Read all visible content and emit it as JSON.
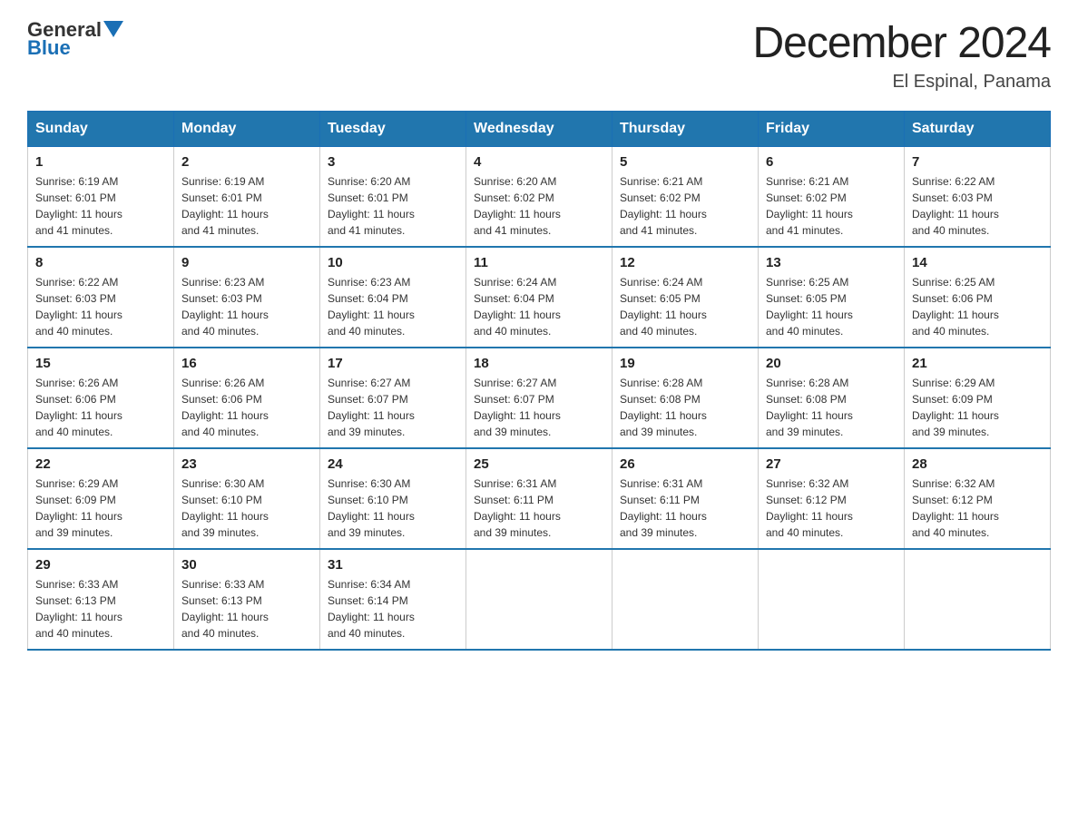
{
  "header": {
    "logo_general": "General",
    "logo_blue": "Blue",
    "title": "December 2024",
    "location": "El Espinal, Panama"
  },
  "weekdays": [
    "Sunday",
    "Monday",
    "Tuesday",
    "Wednesday",
    "Thursday",
    "Friday",
    "Saturday"
  ],
  "weeks": [
    [
      {
        "day": "1",
        "sunrise": "6:19 AM",
        "sunset": "6:01 PM",
        "daylight": "11 hours and 41 minutes."
      },
      {
        "day": "2",
        "sunrise": "6:19 AM",
        "sunset": "6:01 PM",
        "daylight": "11 hours and 41 minutes."
      },
      {
        "day": "3",
        "sunrise": "6:20 AM",
        "sunset": "6:01 PM",
        "daylight": "11 hours and 41 minutes."
      },
      {
        "day": "4",
        "sunrise": "6:20 AM",
        "sunset": "6:02 PM",
        "daylight": "11 hours and 41 minutes."
      },
      {
        "day": "5",
        "sunrise": "6:21 AM",
        "sunset": "6:02 PM",
        "daylight": "11 hours and 41 minutes."
      },
      {
        "day": "6",
        "sunrise": "6:21 AM",
        "sunset": "6:02 PM",
        "daylight": "11 hours and 41 minutes."
      },
      {
        "day": "7",
        "sunrise": "6:22 AM",
        "sunset": "6:03 PM",
        "daylight": "11 hours and 40 minutes."
      }
    ],
    [
      {
        "day": "8",
        "sunrise": "6:22 AM",
        "sunset": "6:03 PM",
        "daylight": "11 hours and 40 minutes."
      },
      {
        "day": "9",
        "sunrise": "6:23 AM",
        "sunset": "6:03 PM",
        "daylight": "11 hours and 40 minutes."
      },
      {
        "day": "10",
        "sunrise": "6:23 AM",
        "sunset": "6:04 PM",
        "daylight": "11 hours and 40 minutes."
      },
      {
        "day": "11",
        "sunrise": "6:24 AM",
        "sunset": "6:04 PM",
        "daylight": "11 hours and 40 minutes."
      },
      {
        "day": "12",
        "sunrise": "6:24 AM",
        "sunset": "6:05 PM",
        "daylight": "11 hours and 40 minutes."
      },
      {
        "day": "13",
        "sunrise": "6:25 AM",
        "sunset": "6:05 PM",
        "daylight": "11 hours and 40 minutes."
      },
      {
        "day": "14",
        "sunrise": "6:25 AM",
        "sunset": "6:06 PM",
        "daylight": "11 hours and 40 minutes."
      }
    ],
    [
      {
        "day": "15",
        "sunrise": "6:26 AM",
        "sunset": "6:06 PM",
        "daylight": "11 hours and 40 minutes."
      },
      {
        "day": "16",
        "sunrise": "6:26 AM",
        "sunset": "6:06 PM",
        "daylight": "11 hours and 40 minutes."
      },
      {
        "day": "17",
        "sunrise": "6:27 AM",
        "sunset": "6:07 PM",
        "daylight": "11 hours and 39 minutes."
      },
      {
        "day": "18",
        "sunrise": "6:27 AM",
        "sunset": "6:07 PM",
        "daylight": "11 hours and 39 minutes."
      },
      {
        "day": "19",
        "sunrise": "6:28 AM",
        "sunset": "6:08 PM",
        "daylight": "11 hours and 39 minutes."
      },
      {
        "day": "20",
        "sunrise": "6:28 AM",
        "sunset": "6:08 PM",
        "daylight": "11 hours and 39 minutes."
      },
      {
        "day": "21",
        "sunrise": "6:29 AM",
        "sunset": "6:09 PM",
        "daylight": "11 hours and 39 minutes."
      }
    ],
    [
      {
        "day": "22",
        "sunrise": "6:29 AM",
        "sunset": "6:09 PM",
        "daylight": "11 hours and 39 minutes."
      },
      {
        "day": "23",
        "sunrise": "6:30 AM",
        "sunset": "6:10 PM",
        "daylight": "11 hours and 39 minutes."
      },
      {
        "day": "24",
        "sunrise": "6:30 AM",
        "sunset": "6:10 PM",
        "daylight": "11 hours and 39 minutes."
      },
      {
        "day": "25",
        "sunrise": "6:31 AM",
        "sunset": "6:11 PM",
        "daylight": "11 hours and 39 minutes."
      },
      {
        "day": "26",
        "sunrise": "6:31 AM",
        "sunset": "6:11 PM",
        "daylight": "11 hours and 39 minutes."
      },
      {
        "day": "27",
        "sunrise": "6:32 AM",
        "sunset": "6:12 PM",
        "daylight": "11 hours and 40 minutes."
      },
      {
        "day": "28",
        "sunrise": "6:32 AM",
        "sunset": "6:12 PM",
        "daylight": "11 hours and 40 minutes."
      }
    ],
    [
      {
        "day": "29",
        "sunrise": "6:33 AM",
        "sunset": "6:13 PM",
        "daylight": "11 hours and 40 minutes."
      },
      {
        "day": "30",
        "sunrise": "6:33 AM",
        "sunset": "6:13 PM",
        "daylight": "11 hours and 40 minutes."
      },
      {
        "day": "31",
        "sunrise": "6:34 AM",
        "sunset": "6:14 PM",
        "daylight": "11 hours and 40 minutes."
      },
      null,
      null,
      null,
      null
    ]
  ],
  "labels": {
    "sunrise": "Sunrise:",
    "sunset": "Sunset:",
    "daylight": "Daylight:"
  }
}
